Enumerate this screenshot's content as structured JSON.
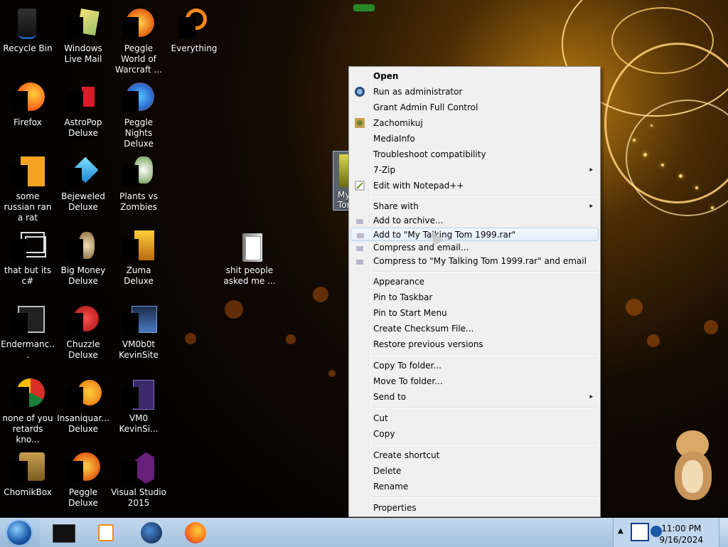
{
  "desktop": {
    "icons": [
      {
        "label": "Recycle Bin",
        "icon": "recycle-bin-icon"
      },
      {
        "label": "Windows Live Mail",
        "icon": "mail-icon"
      },
      {
        "label": "Peggle World of Warcraft ...",
        "icon": "peggle-wow-icon"
      },
      {
        "label": "Everything",
        "icon": "everything-search-icon"
      },
      {
        "label": "Firefox",
        "icon": "firefox-icon"
      },
      {
        "label": "AstroPop Deluxe",
        "icon": "astropop-icon"
      },
      {
        "label": "Peggle Nights Deluxe",
        "icon": "peggle-nights-icon"
      },
      {
        "label": "some russian ran a rat",
        "icon": "rat-app-icon"
      },
      {
        "label": "Bejeweled Deluxe",
        "icon": "bejeweled-icon"
      },
      {
        "label": "Plants vs Zombies",
        "icon": "plants-vs-zombies-icon"
      },
      {
        "label": "that but its c#",
        "icon": "windows-app-icon"
      },
      {
        "label": "Big Money Deluxe",
        "icon": "big-money-icon"
      },
      {
        "label": "Zuma Deluxe",
        "icon": "zuma-icon"
      },
      {
        "label": "shit people asked me ...",
        "icon": "folder-icon"
      },
      {
        "label": "Endermanc...",
        "icon": "console-app-icon"
      },
      {
        "label": "Chuzzle Deluxe",
        "icon": "chuzzle-icon"
      },
      {
        "label": "VM0b0t KevinSite",
        "icon": "vm-icon"
      },
      {
        "label": "none of you retards kno...",
        "icon": "chrome-icon"
      },
      {
        "label": "Insaniquar... Deluxe",
        "icon": "insaniquarium-icon"
      },
      {
        "label": "VM0 KevinSi...",
        "icon": "vm-file-icon"
      },
      {
        "label": "ChomikBox",
        "icon": "chomikbox-icon"
      },
      {
        "label": "Peggle Deluxe",
        "icon": "peggle-icon"
      },
      {
        "label": "Visual Studio 2015",
        "icon": "visual-studio-icon"
      }
    ],
    "selected_file_label": "My Tom"
  },
  "context_menu": {
    "items": [
      {
        "label": "Open",
        "bold": true
      },
      {
        "label": "Run as administrator",
        "icon": "shield-icon"
      },
      {
        "label": "Grant Admin Full Control"
      },
      {
        "label": "Zachomikuj",
        "icon": "chomik-icon"
      },
      {
        "label": "MediaInfo"
      },
      {
        "label": "Troubleshoot compatibility"
      },
      {
        "label": "7-Zip",
        "submenu": true
      },
      {
        "label": "Edit with Notepad++",
        "icon": "notepad-plus-icon"
      },
      {
        "label": "Share with",
        "submenu": true
      },
      {
        "label": "Add to archive...",
        "icon": "winrar-icon"
      },
      {
        "label": "Add to \"My Talking Tom 1999.rar\"",
        "icon": "winrar-icon",
        "highlighted": true
      },
      {
        "label": "Compress and email...",
        "icon": "winrar-icon"
      },
      {
        "label": "Compress to \"My Talking Tom 1999.rar\" and email",
        "icon": "winrar-icon"
      },
      {
        "label": "Appearance"
      },
      {
        "label": "Pin to Taskbar"
      },
      {
        "label": "Pin to Start Menu"
      },
      {
        "label": "Create Checksum File..."
      },
      {
        "label": "Restore previous versions"
      },
      {
        "label": "Copy To folder..."
      },
      {
        "label": "Move To folder..."
      },
      {
        "label": "Send to",
        "submenu": true
      },
      {
        "label": "Cut"
      },
      {
        "label": "Copy"
      },
      {
        "label": "Create shortcut"
      },
      {
        "label": "Delete"
      },
      {
        "label": "Rename"
      },
      {
        "label": "Properties"
      }
    ],
    "submenu_arrow": "▸"
  },
  "taskbar": {
    "start_icon": "windows-start-icon",
    "pinned": [
      "terminal-icon",
      "media-player-icon",
      "globe-app-icon",
      "firefox-icon"
    ],
    "tray_arrow": "▲",
    "clock_time": "11:00 PM",
    "clock_date": "9/16/2024"
  },
  "colors": {
    "menu_bg": "#f0f0f0",
    "menu_highlight_border": "#b9d2f0",
    "taskbar": "#a9c4df"
  }
}
